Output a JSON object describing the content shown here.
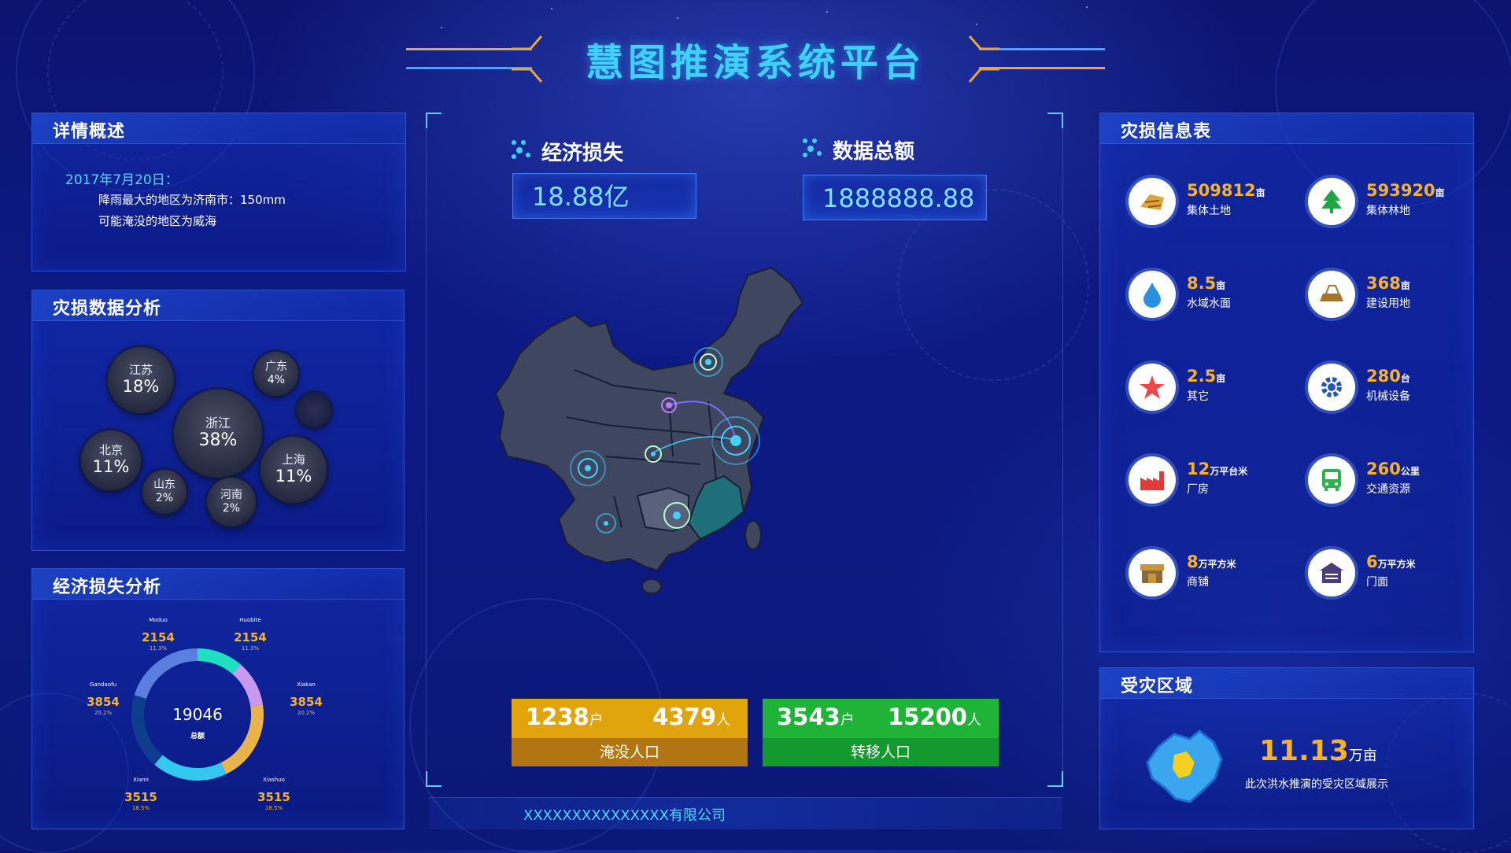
{
  "header": {
    "title": "慧图推演系统平台"
  },
  "details": {
    "title": "详情概述",
    "date": "2017年7月20日：",
    "lines": [
      "降雨最大的地区为济南市：150mm",
      "可能淹没的地区为威海"
    ]
  },
  "damage_analysis": {
    "title": "灾损数据分析",
    "bubbles": [
      {
        "label": "江苏",
        "percent": "18%"
      },
      {
        "label": "广东",
        "percent": "4%"
      },
      {
        "label": "浙江",
        "percent": "38%"
      },
      {
        "label": "北京",
        "percent": "11%"
      },
      {
        "label": "上海",
        "percent": "11%"
      },
      {
        "label": "山东",
        "percent": "2%"
      },
      {
        "label": "河南",
        "percent": "2%"
      }
    ]
  },
  "economic_analysis": {
    "title": "经济损失分析",
    "total_value": "19046",
    "total_label": "总额",
    "segments": [
      {
        "name": "Moduo",
        "value": "2154",
        "pct": "11.3%",
        "color": "#1de0c2"
      },
      {
        "name": "Huobite",
        "value": "2154",
        "pct": "11.3%",
        "color": "#c79af0"
      },
      {
        "name": "Xiakan",
        "value": "3854",
        "pct": "20.2%",
        "color": "#e8b34a"
      },
      {
        "name": "Xiashuo",
        "value": "3515",
        "pct": "18.5%",
        "color": "#32c8ef"
      },
      {
        "name": "Xiami",
        "value": "3515",
        "pct": "18.5%",
        "color": "#0f3d8e"
      },
      {
        "name": "Gandaofu",
        "value": "3854",
        "pct": "20.2%",
        "color": "#5a7fe0"
      }
    ]
  },
  "center": {
    "econ_loss_label": "经济损失",
    "econ_loss_value": "18.88亿",
    "data_total_label": "数据总额",
    "data_total_value": "1888888.88",
    "flooded": {
      "households": "1238",
      "households_unit": "户",
      "people": "4379",
      "people_unit": "人",
      "label": "淹没人口",
      "color_top": "#e2a40c",
      "color_bottom": "#b17514"
    },
    "transferred": {
      "households": "3543",
      "households_unit": "户",
      "people": "15200",
      "people_unit": "人",
      "label": "转移人口",
      "color_top": "#1fb338",
      "color_bottom": "#139a2f"
    },
    "company": "XXXXXXXXXXXXXXX有限公司"
  },
  "damage_info": {
    "title": "灾损信息表",
    "items": [
      {
        "value": "509812",
        "unit": "亩",
        "label": "集体土地",
        "icon": "land-icon"
      },
      {
        "value": "593920",
        "unit": "亩",
        "label": "集体林地",
        "icon": "tree-icon"
      },
      {
        "value": "8.5",
        "unit": "亩",
        "label": "水域水面",
        "icon": "water-drop-icon"
      },
      {
        "value": "368",
        "unit": "亩",
        "label": "建设用地",
        "icon": "construction-icon"
      },
      {
        "value": "2.5",
        "unit": "亩",
        "label": "其它",
        "icon": "star-icon"
      },
      {
        "value": "280",
        "unit": "台",
        "label": "机械设备",
        "icon": "gear-icon"
      },
      {
        "value": "12",
        "unit": "万平台米",
        "label": "厂房",
        "icon": "factory-icon"
      },
      {
        "value": "260",
        "unit": "公里",
        "label": "交通资源",
        "icon": "bus-icon"
      },
      {
        "value": "8",
        "unit": "万平方米",
        "label": "商铺",
        "icon": "shop-icon"
      },
      {
        "value": "6",
        "unit": "万平方米",
        "label": "门面",
        "icon": "storefront-icon"
      }
    ]
  },
  "affected_region": {
    "title": "受灾区域",
    "value": "11.13",
    "unit": "万亩",
    "description": "此次洪水推演的受灾区域展示"
  }
}
